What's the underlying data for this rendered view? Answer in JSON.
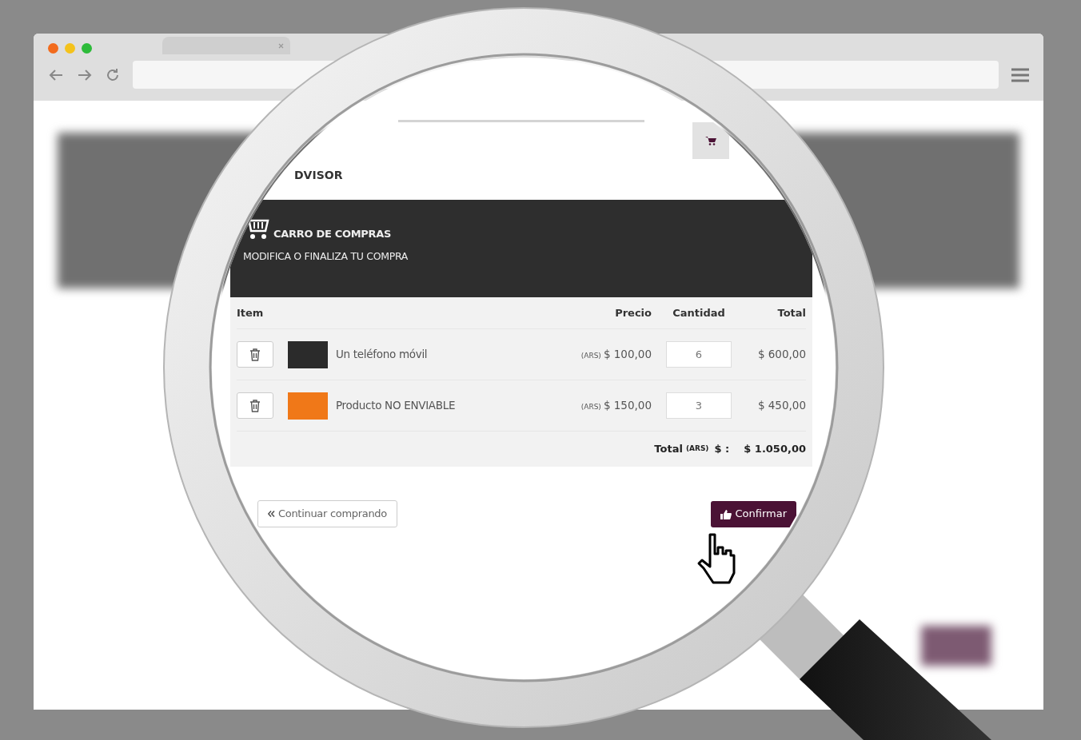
{
  "page": {
    "brand": "DVISOR",
    "header": {
      "title": "CARRO DE COMPRAS",
      "subtitle": "MODIFICA O FINALIZA TU COMPRA"
    },
    "table": {
      "columns": [
        "Item",
        "Precio",
        "Cantidad",
        "Total"
      ],
      "rows": [
        {
          "name": "Un teléfono móvil",
          "currency": "(ARS)",
          "price": "$ 100,00",
          "quantity": "6",
          "total": "$ 600,00",
          "color": "#2b2b2b"
        },
        {
          "name": "Producto NO ENVIABLE",
          "currency": "(ARS)",
          "price": "$ 150,00",
          "quantity": "3",
          "total": "$ 450,00",
          "color": "#f07818"
        }
      ],
      "footer": {
        "label": "Total",
        "currency": "(ARS)",
        "symbol": "$ :",
        "value": "$ 1.050,00"
      }
    },
    "buttons": {
      "continue": "Continuar comprando",
      "confirm": "Confirmar"
    }
  }
}
